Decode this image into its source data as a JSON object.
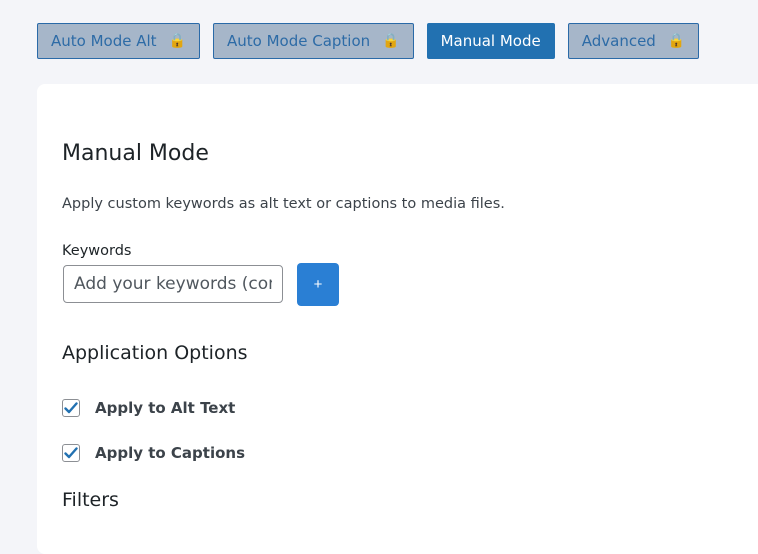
{
  "tabs": [
    {
      "label": "Auto Mode Alt",
      "locked": true,
      "active": false
    },
    {
      "label": "Auto Mode Caption",
      "locked": true,
      "active": false
    },
    {
      "label": "Manual Mode",
      "locked": false,
      "active": true
    },
    {
      "label": "Advanced",
      "locked": true,
      "active": false
    }
  ],
  "lock_glyph": "🔒",
  "main": {
    "title": "Manual Mode",
    "description": "Apply custom keywords as alt text or captions to media files.",
    "keywords": {
      "label": "Keywords",
      "placeholder": "Add your keywords (comma separated)",
      "value": "",
      "add_label": "+"
    },
    "application_options": {
      "title": "Application Options",
      "options": [
        {
          "label": "Apply to Alt Text",
          "checked": true
        },
        {
          "label": "Apply to Captions",
          "checked": true
        }
      ]
    },
    "filters": {
      "title": "Filters"
    }
  },
  "colors": {
    "accent": "#2271b1",
    "button": "#2a7fd4",
    "locked_tab_bg": "#a6b6c9",
    "check": "#2271b1"
  }
}
